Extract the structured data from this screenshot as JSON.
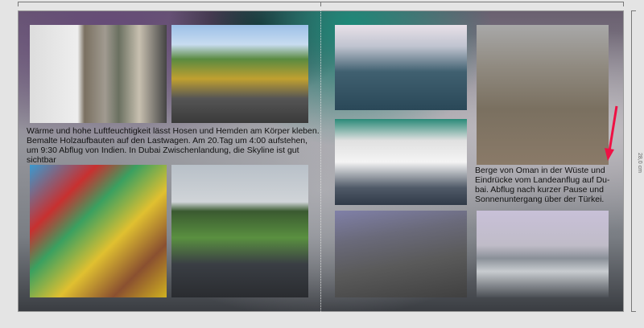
{
  "ruler": {
    "size_label": "28,0 cm"
  },
  "left_page": {
    "caption": "Wärme und hohe Luftfeuchtigkeit lässt Hosen und Hemden am Körper kleben. Bemalte Holzaufbauten auf den Lastwagen. Am 20.Tag um 4:00 aufstehen, um 9:30 Abflug von Indien. In Dubai Zwischenlandung, die Skyline ist gut sichtbar"
  },
  "right_page": {
    "caption": "Berge von Oman in der Wüste und Eindrücke vom Landeanflug auf Du-bai. Abflug nach kurzer Pause und Sonnenuntergang über der Türkei."
  },
  "colors": {
    "arrow": "#ee1144"
  }
}
